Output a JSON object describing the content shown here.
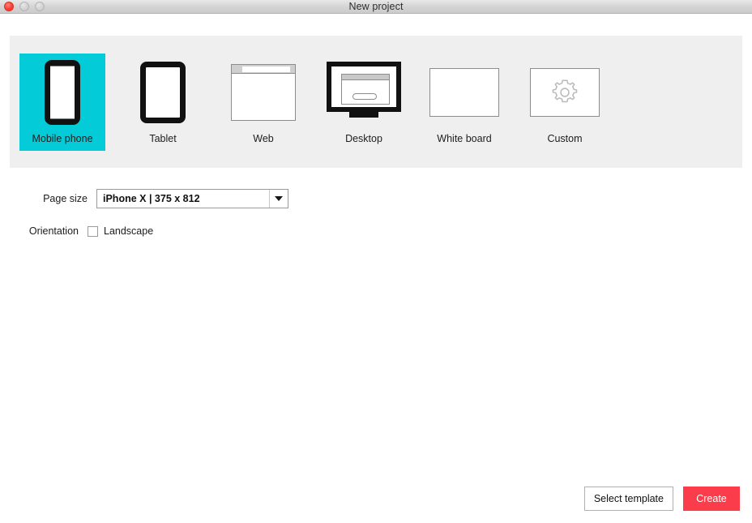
{
  "window": {
    "title": "New project",
    "controls": {
      "close": "close-button",
      "minimize": "minimize-button",
      "maximize": "maximize-button"
    }
  },
  "template_panel": {
    "selected_index": 0,
    "selected_color": "#03ccd8",
    "tiles": [
      {
        "label": "Mobile phone",
        "icon": "mobile-phone-icon",
        "selected": true
      },
      {
        "label": "Tablet",
        "icon": "tablet-icon",
        "selected": false
      },
      {
        "label": "Web",
        "icon": "web-browser-icon",
        "selected": false
      },
      {
        "label": "Desktop",
        "icon": "desktop-monitor-icon",
        "selected": false
      },
      {
        "label": "White board",
        "icon": "white-board-icon",
        "selected": false
      },
      {
        "label": "Custom",
        "icon": "gear-icon",
        "selected": false
      }
    ]
  },
  "form": {
    "page_size": {
      "label": "Page size",
      "value": "iPhone X | 375 x 812"
    },
    "orientation": {
      "label": "Orientation",
      "checkbox_label": "Landscape",
      "checked": false
    }
  },
  "footer": {
    "select_template_label": "Select template",
    "create_label": "Create",
    "create_color": "#fa3c4b"
  }
}
